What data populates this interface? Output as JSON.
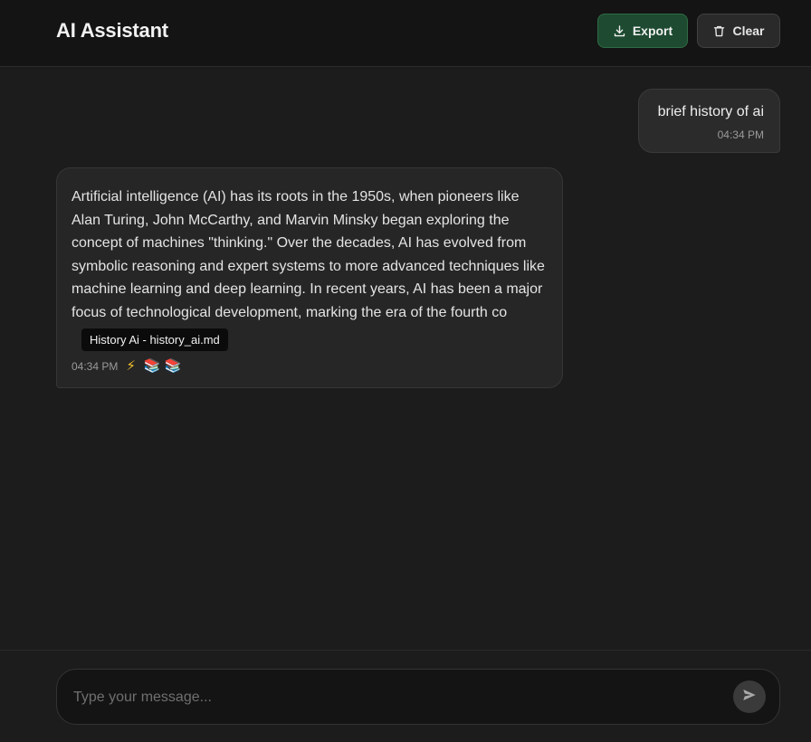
{
  "header": {
    "title": "AI Assistant",
    "export_label": "Export",
    "clear_label": "Clear",
    "export_icon": "download-icon",
    "clear_icon": "trash-icon"
  },
  "messages": [
    {
      "role": "user",
      "text": "brief history of ai",
      "time": "04:34 PM"
    },
    {
      "role": "assistant",
      "text": "Artificial intelligence (AI) has its roots in the 1950s, when pioneers like Alan Turing, John McCarthy, and Marvin Minsky began exploring the concept of machines \"thinking.\" Over the decades, AI has evolved from symbolic reasoning and expert systems to more advanced techniques like machine learning and deep learning. In recent years, AI has been a major focus of technological development, marking the era of the fourth co",
      "time": "04:34 PM",
      "badges": [
        "⚡",
        "📚",
        "📚"
      ],
      "tooltip": "History Ai - history_ai.md"
    }
  ],
  "composer": {
    "placeholder": "Type your message...",
    "value": "",
    "send_icon": "send-icon"
  },
  "colors": {
    "background": "#1c1c1c",
    "header_bg": "#141414",
    "export_bg": "#1d4a30",
    "bubble_user": "#2b2b2b",
    "bubble_ai": "#262626"
  }
}
